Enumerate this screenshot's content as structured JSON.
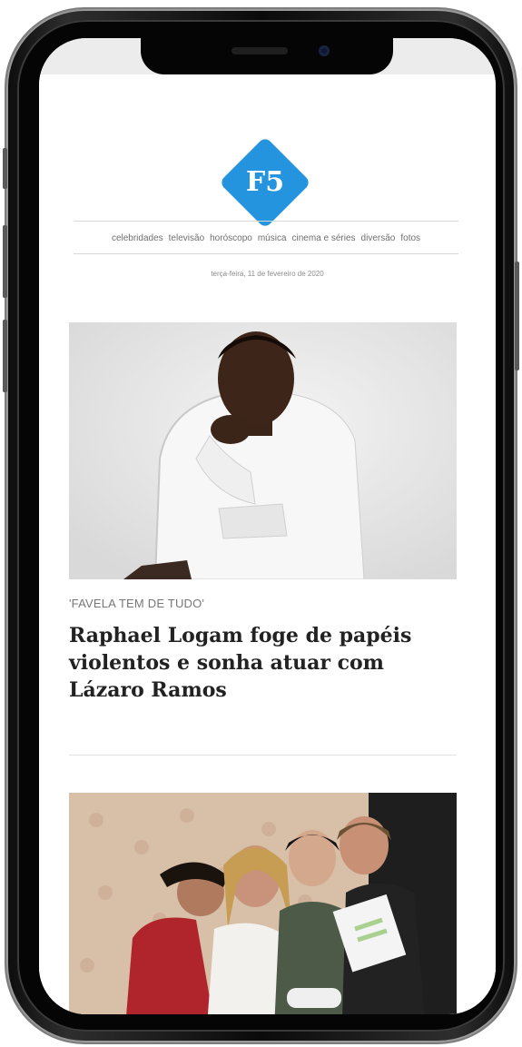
{
  "brand": {
    "logo_text": "F5",
    "color": "#2594de"
  },
  "nav": {
    "items": [
      {
        "label": "celebridades"
      },
      {
        "label": "televisão"
      },
      {
        "label": "horóscopo"
      },
      {
        "label": "música"
      },
      {
        "label": "cinema e séries"
      },
      {
        "label": "diversão"
      },
      {
        "label": "fotos"
      }
    ]
  },
  "date": "terça-feira, 11 de fevereiro de 2020",
  "articles": [
    {
      "kicker": "'FAVELA TEM DE TUDO'",
      "headline": "Raphael Logam foge de papéis violentos e sonha atuar com Lázaro Ramos",
      "image": "portrait-photo"
    },
    {
      "image": "group-photo"
    }
  ],
  "colors": {
    "frame": "#0c0c0c",
    "text_dark": "#222222",
    "text_muted": "#777777"
  }
}
